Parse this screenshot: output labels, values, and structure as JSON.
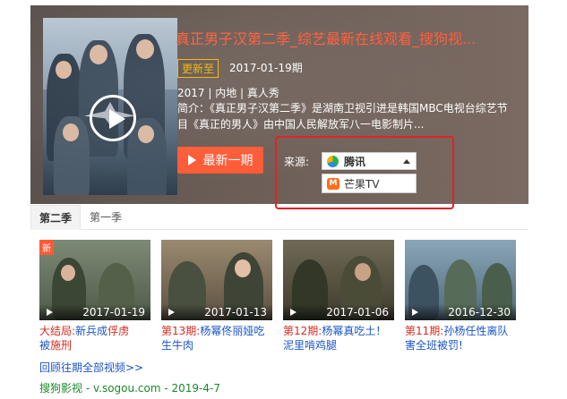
{
  "hero": {
    "title": "真正男子汉第二季_综艺最新在线观看_搜狗视...",
    "update_badge": "更新至",
    "update_date": "2017-01-19期",
    "meta": "2017 | 内地 | 真人秀",
    "description": "简介：《真正男子汉第二季》是湖南卫视引进是韩国MBC电视台综艺节目《真正的男人》由中国人民解放军八一电影制片...",
    "latest_button": "最新一期",
    "source_label": "来源:",
    "source_selected": "腾讯",
    "source_options": [
      "芒果TV"
    ],
    "colors": {
      "accent": "#ff5a36",
      "title": "#ff5e3a",
      "badge": "#f5b400",
      "highlight_frame": "#e32222"
    }
  },
  "tabs": [
    "第二季",
    "第一季"
  ],
  "episodes": [
    {
      "date": "2017-01-19",
      "badge": "新",
      "title_hl": "大结局:",
      "title": "新兵成",
      "title_hl2": "俘虏",
      "title_tail": "被",
      "title_hl3": "施刑"
    },
    {
      "date": "2017-01-13",
      "title_hl": "第13期:",
      "title": "杨幂佟丽娅吃生牛肉"
    },
    {
      "date": "2017-01-06",
      "title_hl": "第12期:",
      "title": "杨幂真吃土！泥里啃鸡腿"
    },
    {
      "date": "2016-12-30",
      "title_hl": "第11期:",
      "title": "孙杨任性离队害全班被罚!"
    }
  ],
  "more_link": "回顾往期全部视频>>",
  "source_line": "搜狗影视 - v.sogou.com - 2019-4-7",
  "icons": {
    "play": "play-icon",
    "tencent": "tencent-video-logo",
    "mango": "mango-tv-logo",
    "caret": "caret-up-icon"
  }
}
